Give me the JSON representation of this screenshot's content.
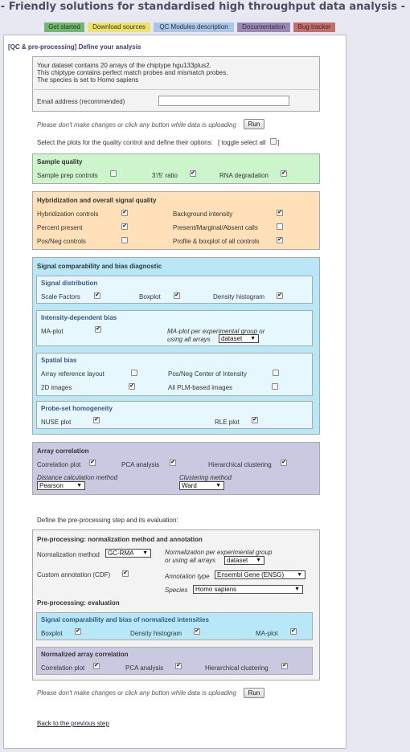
{
  "header": {
    "tagline": "- Friendly solutions for standardised high throughput data analysis -"
  },
  "nav": {
    "tabs": [
      {
        "label": "Get started",
        "color": "#6fb96f"
      },
      {
        "label": "Download sources",
        "color": "#efe26a"
      },
      {
        "label": "QC Modules description",
        "color": "#aac4ea"
      },
      {
        "label": "Documentation",
        "color": "#9a87b8"
      },
      {
        "label": "Bug tracker",
        "color": "#c86b6b"
      }
    ]
  },
  "page": {
    "title": "[QC & pre-processing] Define your analysis",
    "info_lines": [
      "Your dataset contains 20 arrays of the chiptype hgu133plus2.",
      "This chiptype contains perfect match probes and mismatch probes.",
      "The species is set to Homo sapiens"
    ],
    "email_label": "Email address (recommended)",
    "email_value": "",
    "upload_note": "Please don't make changes or click any button while data is uploading",
    "run_label": "Run",
    "select_plots_text": "Select the plots for the quality control and define their options:",
    "toggle_all_label": "[ toggle select all",
    "toggle_all_close": "]",
    "toggle_all_checked": false
  },
  "sample_quality": {
    "title": "Sample quality",
    "color": "#ccf5cc",
    "items": [
      {
        "label": "Sample prep controls",
        "checked": false
      },
      {
        "label": "3'/5' ratio",
        "checked": true
      },
      {
        "label": "RNA degradation",
        "checked": true
      }
    ]
  },
  "hybridization": {
    "title": "Hybridization and overall signal quality",
    "color": "#ffe0b8",
    "items": [
      {
        "label": "Hybridization controls",
        "checked": true
      },
      {
        "label": "Background intensity",
        "checked": true
      },
      {
        "label": "Percent present",
        "checked": true
      },
      {
        "label": "Present/Marginal/Absent calls",
        "checked": false
      },
      {
        "label": "Pos/Neg controls",
        "checked": false
      },
      {
        "label": "Profile & boxplot of all controls",
        "checked": true
      }
    ]
  },
  "signal_comparability": {
    "title": "Signal comparability and bias diagnostic",
    "color": "#b8e8f8",
    "signal_distribution": {
      "title": "Signal distribution",
      "items": [
        {
          "label": "Scale Factors",
          "checked": true
        },
        {
          "label": "Boxplot",
          "checked": true
        },
        {
          "label": "Density histogram",
          "checked": true
        }
      ]
    },
    "intensity_bias": {
      "title": "Intensity-dependent bias",
      "ma_plot_label": "MA-plot",
      "ma_plot_checked": true,
      "group_label_1": "MA-plot per experimental group or",
      "group_label_2": "using all arrays",
      "group_select": "dataset"
    },
    "spatial_bias": {
      "title": "Spatial bias",
      "items": [
        {
          "label": "Array reference layout",
          "checked": false
        },
        {
          "label": "Pos/Neg Center of Intensity",
          "checked": false
        },
        {
          "label": "2D images",
          "checked": true
        },
        {
          "label": "All PLM-based images",
          "checked": false
        }
      ]
    },
    "probeset": {
      "title": "Probe-set homogeneity",
      "items": [
        {
          "label": "NUSE plot",
          "checked": true
        },
        {
          "label": "RLE plot",
          "checked": true
        }
      ]
    }
  },
  "array_correlation": {
    "title": "Array correlation",
    "color": "#c9c9e2",
    "items": [
      {
        "label": "Correlation plot",
        "checked": true
      },
      {
        "label": "PCA analysis",
        "checked": true
      },
      {
        "label": "Hierarchical clustering",
        "checked": true
      }
    ],
    "distance_label": "Distance calculation method",
    "distance_value": "Pearson",
    "clustering_label": "Clustering method",
    "clustering_value": "Ward"
  },
  "preprocessing": {
    "define_text": "Define the pre-processing step and its evaluation:",
    "title": "Pre-processing: normalization method and annotation",
    "norm_label": "Normalization method",
    "norm_value": "GC-RMA",
    "norm_group_label_1": "Normalization per experimental group",
    "norm_group_label_2": "or using all arrays",
    "norm_group_value": "dataset",
    "custom_annot_label": "Custom annotation (CDF)",
    "custom_annot_checked": true,
    "annot_type_label": "Annotation type",
    "annot_type_value": "Ensembl Gene (ENSG)",
    "species_label": "Species",
    "species_value": "Homo sapiens",
    "evaluation_title": "Pre-processing: evaluation",
    "norm_signal_box": {
      "title": "Signal comparability and bias of normalized intensities",
      "color": "#b8e8f8",
      "items": [
        {
          "label": "Boxplot",
          "checked": true
        },
        {
          "label": "Density histogram",
          "checked": true
        },
        {
          "label": "MA-plot",
          "checked": true
        }
      ]
    },
    "norm_corr_box": {
      "title": "Normalized array correlation",
      "color": "#c9c9e2",
      "items": [
        {
          "label": "Correlation plot",
          "checked": true
        },
        {
          "label": "PCA analysis",
          "checked": true
        },
        {
          "label": "Hierarchical clustering",
          "checked": true
        }
      ]
    },
    "upload_note": "Please don't make changes or click any button while data is uploading",
    "run_label": "Run"
  },
  "footer": {
    "back_link": "Back to the previous step"
  }
}
